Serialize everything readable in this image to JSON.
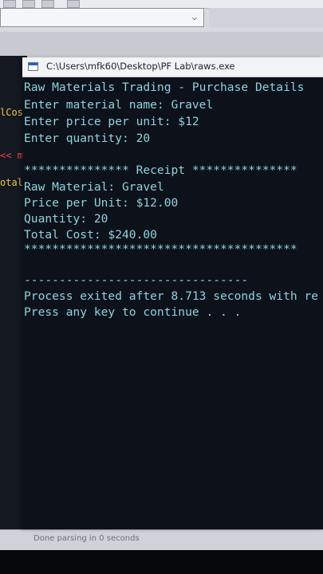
{
  "ide": {
    "code_fragments": [
      "lCos",
      "<< ma",
      "otalC"
    ],
    "status": "Done parsing in 0 seconds"
  },
  "console": {
    "title": "C:\\Users\\mfk60\\Desktop\\PF Lab\\raws.exe",
    "lines": [
      "Raw Materials Trading - Purchase Details",
      "Enter material name: Gravel",
      "Enter price per unit: $12",
      "Enter quantity: 20",
      "",
      "*************** Receipt ***************",
      "Raw Material: Gravel",
      "Price per Unit: $12.00",
      "Quantity: 20",
      "Total Cost: $240.00",
      "***************************************",
      "",
      "",
      "--------------------------------",
      "Process exited after 8.713 seconds with re",
      "Press any key to continue . . ."
    ]
  },
  "colors": {
    "console_bg": "#0d1119",
    "console_text": "#8fd3df",
    "code_yellow": "#e9c64a",
    "code_red": "#e8454d"
  }
}
